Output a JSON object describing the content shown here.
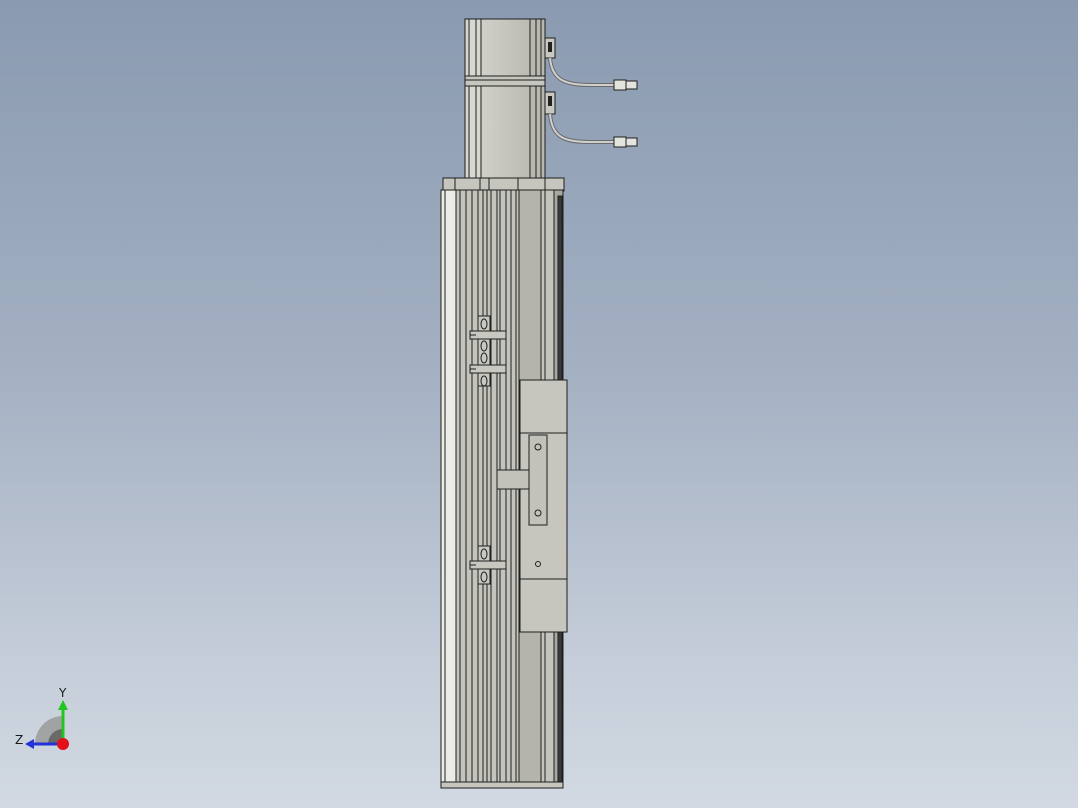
{
  "viewport": {
    "background_top": "#8a9ab0",
    "background_bottom": "#d2d9e2"
  },
  "model": {
    "name": "linear-actuator-module",
    "body_color": "#c3c3bb",
    "shade_color": "#a8a8a0",
    "edge_color": "#1e1e1e",
    "cable_color": "#c8c8c8",
    "connector_color": "#e4e4de"
  },
  "triad": {
    "y_label": "Y",
    "z_label": "Z",
    "y_color": "#22c41f",
    "z_color": "#2432d8",
    "x_color": "#e3101a"
  }
}
